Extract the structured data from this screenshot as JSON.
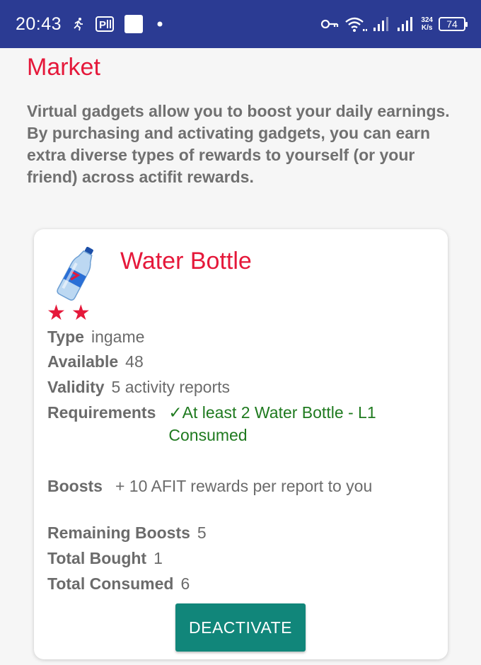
{
  "status_bar": {
    "time": "20:43",
    "network_speed_value": "324",
    "network_speed_unit": "K/s",
    "battery": "74",
    "icons": [
      "run-icon",
      "parking-icon",
      "square-icon",
      "dot-icon",
      "key-icon",
      "wifi-icon",
      "signal-icon",
      "signal-icon-2"
    ]
  },
  "page": {
    "title": "Market",
    "intro": "Virtual gadgets allow you to boost your daily earnings. By purchasing and activating gadgets, you can earn extra diverse types of rewards to yourself (or your friend) across actifit rewards."
  },
  "gadget": {
    "name": "Water Bottle",
    "stars": 2,
    "type_label": "Type",
    "type_value": "ingame",
    "available_label": "Available",
    "available_value": "48",
    "validity_label": "Validity",
    "validity_value": "5 activity reports",
    "requirements_label": "Requirements",
    "requirements_value": "✓At least 2 Water Bottle - L1 Consumed",
    "boosts_label": "Boosts",
    "boosts_value": "+ 10 AFIT rewards per report to you",
    "remaining_label": "Remaining Boosts",
    "remaining_value": "5",
    "bought_label": "Total Bought",
    "bought_value": "1",
    "consumed_label": "Total Consumed",
    "consumed_value": "6",
    "button_label": "DEACTIVATE"
  },
  "colors": {
    "status_bar": "#2b3b93",
    "accent_red": "#e5183a",
    "button_teal": "#11867a",
    "requirement_green": "#1f7a1f"
  }
}
